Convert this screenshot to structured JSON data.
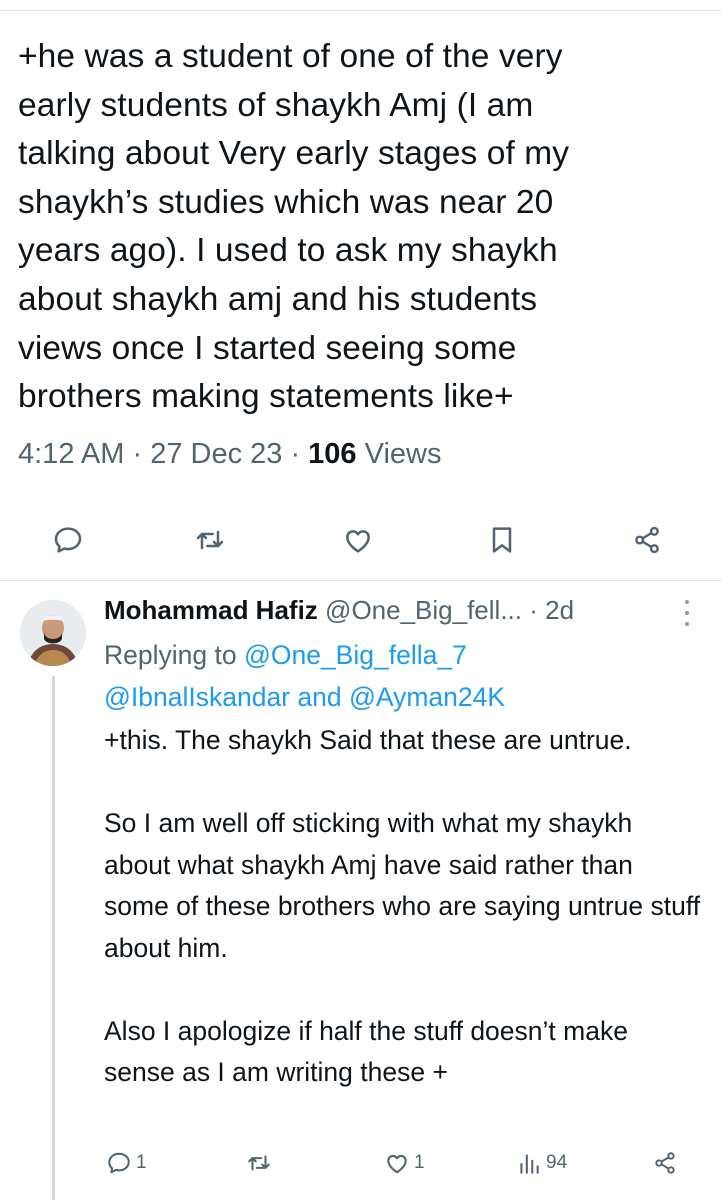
{
  "main_tweet": {
    "text": "+he was a student of one of the very\nearly students of shaykh Amj (I am\ntalking about Very early stages of my\nshaykh’s studies which was near 20\nyears ago). I used to ask my shaykh\nabout shaykh amj and his students\nviews once I started seeing some\nbrothers making statements like+",
    "time": "4:12 AM",
    "date": "27 Dec 23",
    "views_count": "106",
    "views_label": "Views"
  },
  "main_actions": [
    {
      "icon": "reply-icon"
    },
    {
      "icon": "retweet-icon"
    },
    {
      "icon": "like-icon"
    },
    {
      "icon": "bookmark-icon"
    },
    {
      "icon": "share-icon"
    }
  ],
  "reply": {
    "name": "Mohammad Hafiz",
    "handle": "@One_Big_fell...",
    "time": "2d",
    "replying_prefix": "Replying to",
    "mention1": "@One_Big_fella_7",
    "mention2": "@IbnalIskandar",
    "and_word": "and",
    "mention3": "@Ayman24K",
    "paragraphs": [
      "+this. The shaykh Said that these are untrue.",
      "So I am well off sticking with what my shaykh about what shaykh Amj have said rather than some of these brothers who are saying untrue stuff about him.",
      "Also I apologize if half the stuff doesn’t make sense as I am writing these +"
    ],
    "reply_count": "1",
    "retweet_count": "",
    "like_count": "1",
    "views_count": "94"
  },
  "colors": {
    "text": "#0f1419",
    "secondary": "#536471",
    "link": "#1d9bf0",
    "divider": "#e1e8ed"
  }
}
